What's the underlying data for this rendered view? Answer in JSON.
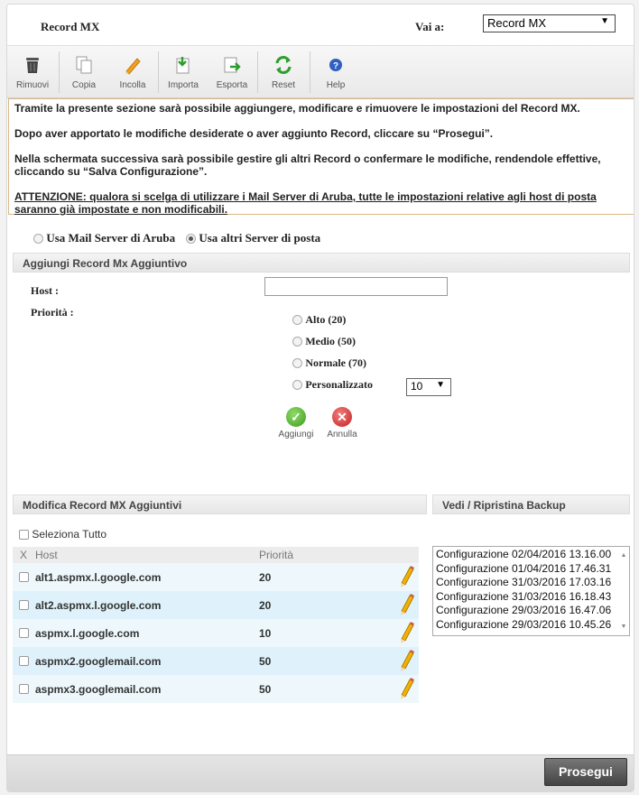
{
  "window": {
    "title": "Record MX",
    "goto_label": "Vai a:",
    "goto_value": "Record MX"
  },
  "toolbar": {
    "buttons": [
      {
        "label": "Rimuovi",
        "icon": "trash-icon"
      },
      {
        "label": "Copia",
        "icon": "copy-icon"
      },
      {
        "label": "Incolla",
        "icon": "pencil-icon"
      },
      {
        "label": "Importa",
        "icon": "import-icon"
      },
      {
        "label": "Esporta",
        "icon": "export-icon"
      },
      {
        "label": "Reset",
        "icon": "reset-icon"
      },
      {
        "label": "Help",
        "icon": "help-icon"
      }
    ]
  },
  "info": {
    "p1": "Tramite la presente sezione sarà possibile aggiungere, modificare e rimuovere le impostazioni del Record MX.",
    "p2": "Dopo aver apportato le modifiche desiderate o aver aggiunto Record, cliccare su “Prosegui”.",
    "p3": "Nella schermata successiva sarà possibile gestire gli altri Record o confermare le modifiche, rendendole effettive, cliccando su “Salva Configurazione”.",
    "p4": "ATTENZIONE: qualora si scelga di utilizzare i Mail Server di Aruba, tutte le impostazioni relative agli host di posta saranno già impostate e non modificabili."
  },
  "server_choice": {
    "option1": "Usa Mail Server di Aruba",
    "option2": "Usa altri Server di posta",
    "selected": "option2"
  },
  "add_section": {
    "heading": "Aggiungi Record Mx Aggiuntivo",
    "host_label": "Host :",
    "host_value": "",
    "priority_label": "Priorità :",
    "priorities": [
      "Alto (20)",
      "Medio (50)",
      "Normale (70)",
      "Personalizzato"
    ],
    "custom_value": "10",
    "add_label": "Aggiungi",
    "cancel_label": "Annulla"
  },
  "modify_section": {
    "heading": "Modifica Record MX Aggiuntivi",
    "select_all": "Seleziona Tutto",
    "col_x": "X",
    "col_host": "Host",
    "col_priority": "Priorità",
    "rows": [
      {
        "host": "alt1.aspmx.l.google.com",
        "priority": "20"
      },
      {
        "host": "alt2.aspmx.l.google.com",
        "priority": "20"
      },
      {
        "host": "aspmx.l.google.com",
        "priority": "10"
      },
      {
        "host": "aspmx2.googlemail.com",
        "priority": "50"
      },
      {
        "host": "aspmx3.googlemail.com",
        "priority": "50"
      }
    ]
  },
  "backup_section": {
    "heading": "Vedi / Ripristina Backup",
    "items": [
      "Configurazione 02/04/2016 13.16.00",
      "Configurazione 01/04/2016 17.46.31",
      "Configurazione 31/03/2016 17.03.16",
      "Configurazione 31/03/2016 16.18.43",
      "Configurazione 29/03/2016 16.47.06",
      "Configurazione 29/03/2016 10.45.26"
    ]
  },
  "footer": {
    "proceed_label": "Prosegui"
  },
  "colors": {
    "row_light": "#eef8fc",
    "row_dark": "#dff1fa",
    "info_border": "#d8b887"
  }
}
